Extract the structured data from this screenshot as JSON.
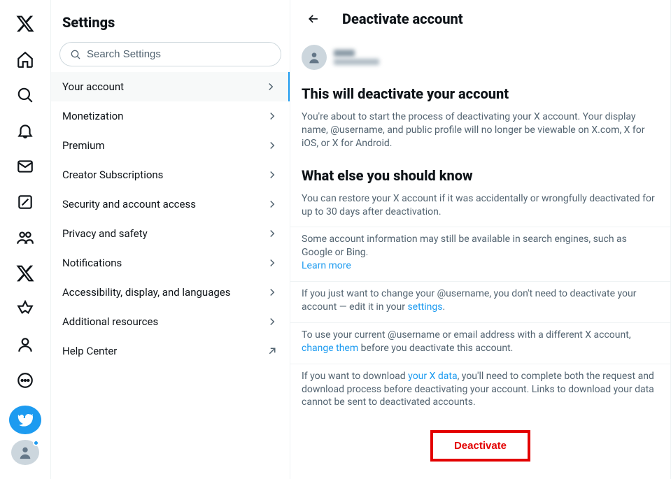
{
  "settings": {
    "title": "Settings",
    "search_placeholder": "Search Settings",
    "items": [
      {
        "label": "Your account",
        "active": true,
        "icon": "chevron"
      },
      {
        "label": "Monetization",
        "icon": "chevron"
      },
      {
        "label": "Premium",
        "icon": "chevron"
      },
      {
        "label": "Creator Subscriptions",
        "icon": "chevron"
      },
      {
        "label": "Security and account access",
        "icon": "chevron"
      },
      {
        "label": "Privacy and safety",
        "icon": "chevron"
      },
      {
        "label": "Notifications",
        "icon": "chevron"
      },
      {
        "label": "Accessibility, display, and languages",
        "icon": "chevron"
      },
      {
        "label": "Additional resources",
        "icon": "chevron"
      },
      {
        "label": "Help Center",
        "icon": "external"
      }
    ]
  },
  "detail": {
    "title": "Deactivate account",
    "heading1": "This will deactivate your account",
    "para1": "You're about to start the process of deactivating your X account. Your display name, @username, and public profile will no longer be viewable on X.com, X for iOS, or X for Android.",
    "heading2": "What else you should know",
    "para2": "You can restore your X account if it was accidentally or wrongfully deactivated for up to 30 days after deactivation.",
    "para3_a": "Some account information may still be available in search engines, such as Google or Bing. ",
    "para3_link": "Learn more",
    "para4_a": "If you just want to change your @username, you don't need to deactivate your account — edit it in your ",
    "para4_link": "settings",
    "para4_b": ".",
    "para5_a": "To use your current @username or email address with a different X account, ",
    "para5_link": "change them",
    "para5_b": " before you deactivate this account.",
    "para6_a": "If you want to download ",
    "para6_link": "your X data",
    "para6_b": ", you'll need to complete both the request and download process before deactivating your account. Links to download your data cannot be sent to deactivated accounts.",
    "deactivate_label": "Deactivate"
  },
  "rail": {
    "items": [
      "logo",
      "home",
      "explore",
      "notifications",
      "messages",
      "grok",
      "communities",
      "x-premium",
      "verified-orgs",
      "profile",
      "more"
    ]
  }
}
